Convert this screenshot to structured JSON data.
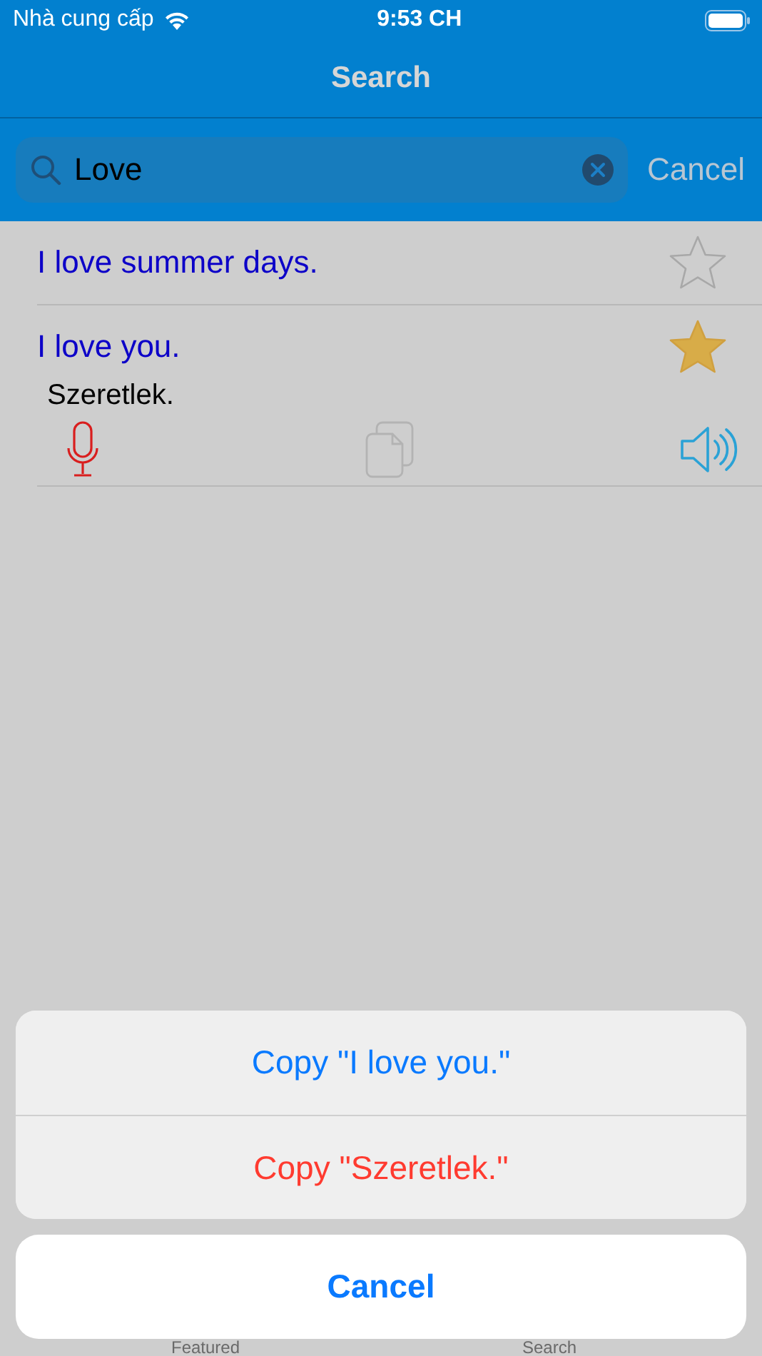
{
  "status_bar": {
    "carrier": "Nhà cung cấp",
    "time": "9:53 CH"
  },
  "nav": {
    "title": "Search"
  },
  "search": {
    "value": "Love",
    "cancel": "Cancel"
  },
  "results": [
    {
      "text": "I love summer days.",
      "favorite": false
    },
    {
      "text": "I love you.",
      "translation": "Szeretlek.",
      "favorite": true
    }
  ],
  "action_sheet": {
    "actions": [
      {
        "label": "Copy \"I love you.\"",
        "kind": "default"
      },
      {
        "label": "Copy \"Szeretlek.\"",
        "kind": "destructive"
      }
    ],
    "cancel": "Cancel"
  },
  "tab_bar": {
    "items": [
      {
        "label": "Featured"
      },
      {
        "label": "Search"
      }
    ]
  }
}
